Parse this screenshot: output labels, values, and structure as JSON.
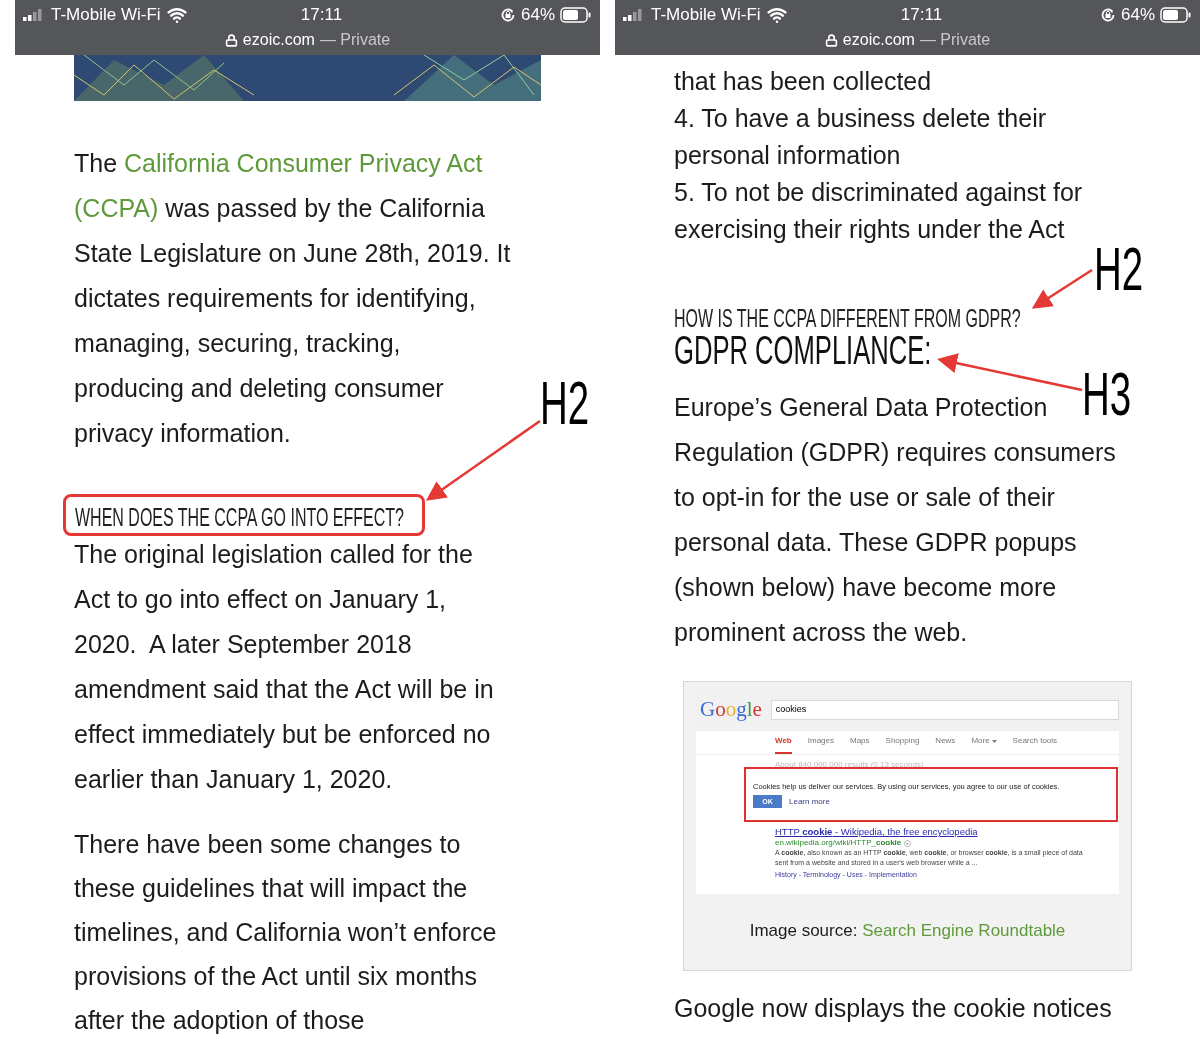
{
  "phones": [
    {
      "status_bar": {
        "carrier": "T-Mobile Wi-Fi",
        "time": "17:11",
        "battery": "64%",
        "domain": "ezoic.com",
        "suffix": "— Private"
      },
      "banner": {
        "kind": "picture"
      },
      "blocks": [
        {
          "kind": "paragraph",
          "lines": [
            [
              {
                "text": "The ",
                "link": false
              },
              {
                "text": "California Consumer Privacy Act",
                "link": true
              }
            ],
            [
              {
                "text": "(CCPA)",
                "link": true
              },
              {
                "text": " was passed by the California",
                "link": false
              }
            ],
            "State Legislature on June 28th, 2019. It",
            "dictates requirements for identifying,",
            "managing, securing, tracking,",
            "producing and deleting consumer",
            "privacy information."
          ]
        },
        {
          "kind": "h2",
          "text": "WHEN DOES THE CCPA GO INTO EFFECT?",
          "highlighted": true
        },
        {
          "kind": "paragraph",
          "lines": [
            "The original legislation called for the",
            "Act to go into effect on January 1,",
            "2020.  A later September 2018",
            "amendment said that the Act will be in",
            "effect immediately but be enforced no",
            "earlier than January 1, 2020."
          ]
        },
        {
          "kind": "paragraph",
          "lines": [
            "There have been some changes to",
            "these guidelines that will impact the",
            "timelines, and California won’t enforce",
            "provisions of the Act until six months",
            "after the adoption of those"
          ]
        }
      ],
      "annotations": [
        {
          "label": "H2"
        }
      ]
    },
    {
      "status_bar": {
        "carrier": "T-Mobile Wi-Fi",
        "time": "17:11",
        "battery": "64%",
        "domain": "ezoic.com",
        "suffix": "— Private"
      },
      "blocks": [
        {
          "kind": "list",
          "lines": [
            "that has been collected",
            "4. To have a business delete their",
            "personal information",
            "5. To not be discriminated against for",
            "exercising their rights under the Act"
          ]
        },
        {
          "kind": "h2",
          "text": "HOW IS THE CCPA DIFFERENT FROM GDPR?",
          "highlighted": false
        },
        {
          "kind": "h3",
          "text": "GDPR COMPLIANCE:"
        },
        {
          "kind": "paragraph",
          "lines": [
            "Europe’s General Data Protection",
            "Regulation (GDPR) requires consumers",
            "to opt-in for the use or sale of their",
            "personal data. These GDPR popups",
            "(shown below) have become more",
            "prominent across the web."
          ]
        },
        {
          "kind": "figure",
          "screenshot": {
            "logo": "Google",
            "query": "cookies",
            "tabs": [
              {
                "label": "Web",
                "selected": true,
                "menu": false
              },
              {
                "label": "Images",
                "selected": false,
                "menu": false
              },
              {
                "label": "Maps",
                "selected": false,
                "menu": false
              },
              {
                "label": "Shopping",
                "selected": false,
                "menu": false
              },
              {
                "label": "News",
                "selected": false,
                "menu": false
              },
              {
                "label": "More",
                "selected": false,
                "menu": true
              },
              {
                "label": "Search tools",
                "selected": false,
                "menu": false
              }
            ],
            "results_count": "About 840,000,000 results (0.13 seconds)",
            "notice": {
              "text": "Cookies help us deliver our services. By using our services, you agree to our use of cookies.",
              "ok": "OK",
              "learn_more": "Learn more"
            },
            "result": {
              "title": "HTTP **cookie** - Wikipedia, the free encyclopedia",
              "url": "en.wikipedia.org/wiki/HTTP_**cookie**",
              "snippet": "A **cookie**, also known as an HTTP **cookie**, web **cookie**, or browser **cookie**, is a small piece of data sent from a website and stored in a user's web browser while a ...",
              "sitelinks": "History - Terminology - Uses - Implementation"
            }
          },
          "caption": "Image source:",
          "caption_link": "Search Engine Roundtable"
        },
        {
          "kind": "paragraph",
          "lines": [
            "Google now displays the cookie notices"
          ]
        }
      ],
      "annotations": [
        {
          "label": "H2"
        },
        {
          "label": "H3"
        }
      ]
    }
  ]
}
